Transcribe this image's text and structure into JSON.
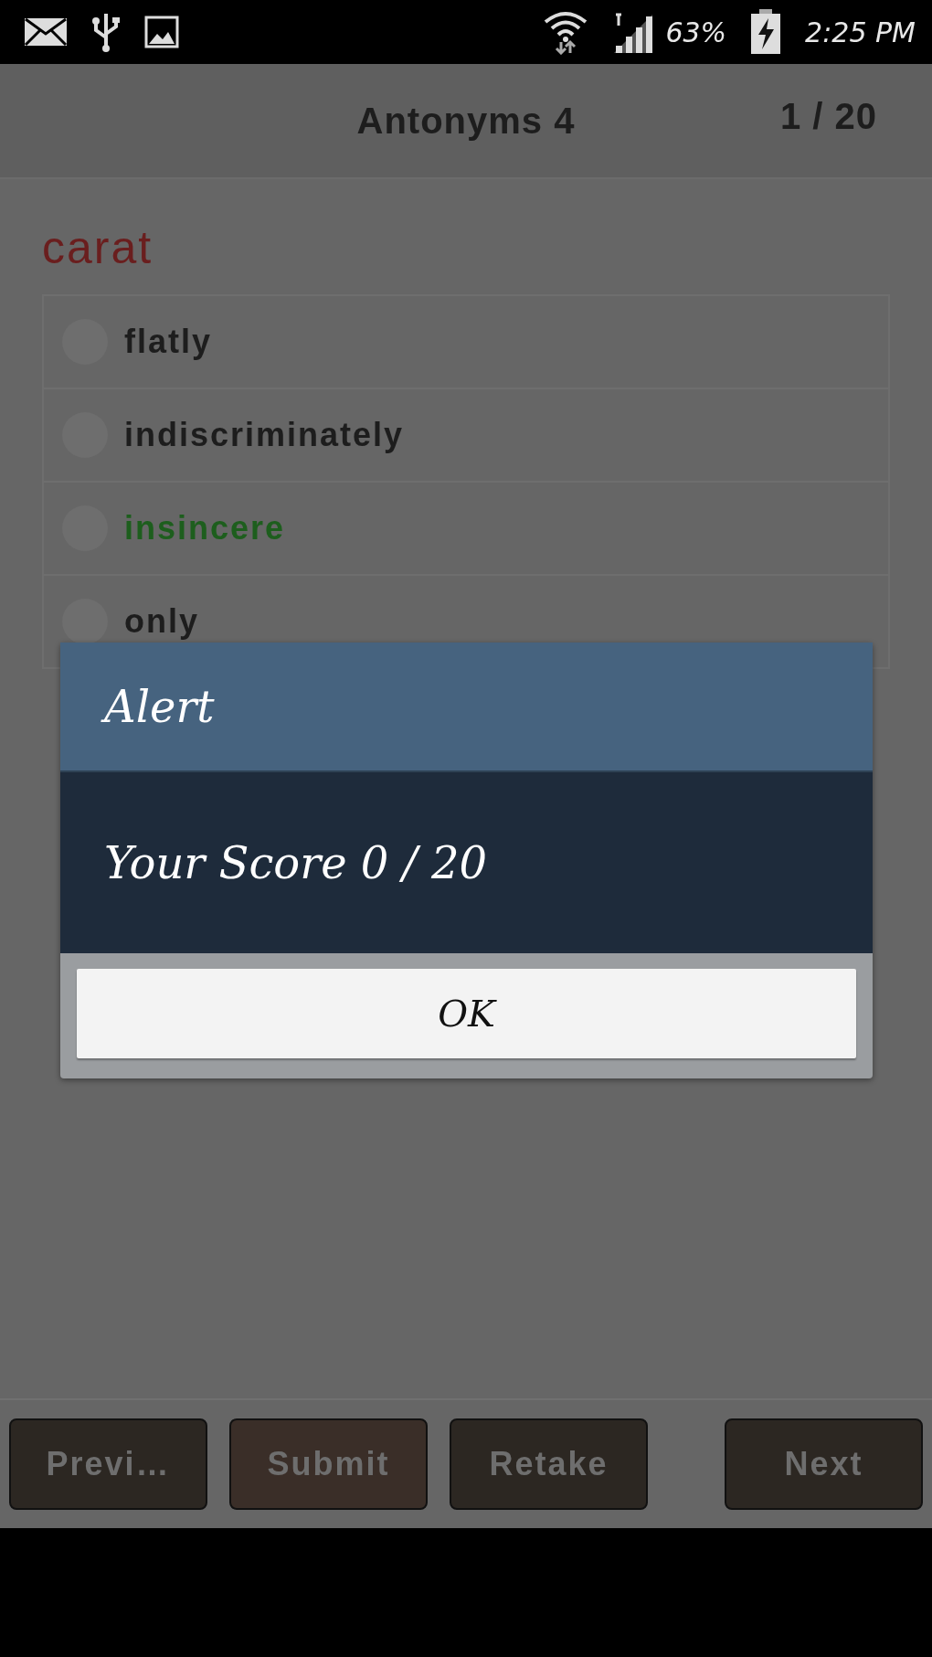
{
  "status_bar": {
    "battery": "63%",
    "time": "2:25 PM"
  },
  "header": {
    "title": "Antonyms 4",
    "progress": "1 / 20"
  },
  "question": {
    "word": "carat"
  },
  "options": [
    {
      "label": "flatly",
      "selected": false,
      "correct": false
    },
    {
      "label": "indiscriminately",
      "selected": false,
      "correct": false
    },
    {
      "label": "insincere",
      "selected": false,
      "correct": true
    },
    {
      "label": "only",
      "selected": false,
      "correct": false
    }
  ],
  "dialog": {
    "title": "Alert",
    "message": "Your Score 0 / 20",
    "button": "OK"
  },
  "buttons": [
    {
      "label": "Previ…",
      "pressed": false
    },
    {
      "label": "Submit",
      "pressed": true
    },
    {
      "label": "Retake",
      "pressed": false
    },
    {
      "label": "Next",
      "pressed": false
    }
  ]
}
